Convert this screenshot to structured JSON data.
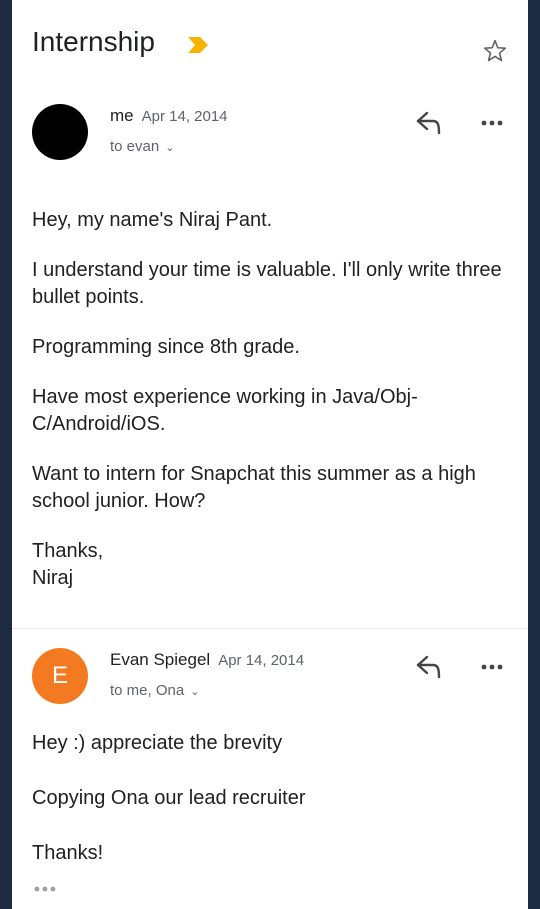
{
  "subject": "Internship",
  "icons": {
    "label": "label-marker-icon",
    "star": "star-icon",
    "reply": "reply-icon",
    "more": "more-horiz-icon",
    "trimmed": "trimmed-content-icon",
    "chevron": "chevron-down-icon"
  },
  "colors": {
    "label_marker": "#f6b400",
    "avatar_e": "#f47a21",
    "secondary_text": "#5f6368"
  },
  "messages": [
    {
      "sender": "me",
      "date": "Apr 14, 2014",
      "recipients": "to evan",
      "avatar_letter": "",
      "body": [
        "Hey, my name's Niraj Pant.",
        "I understand your time is valuable. I'll only write three bullet points.",
        "Programming since 8th grade.",
        "Have most experience working in Java/Obj-C/Android/iOS.",
        "Want to intern for Snapchat this summer as a high school junior. How?",
        "Thanks,\nNiraj"
      ]
    },
    {
      "sender": "Evan Spiegel",
      "date": "Apr 14, 2014",
      "recipients": "to me, Ona",
      "avatar_letter": "E",
      "body": [
        "Hey :) appreciate the brevity",
        "Copying Ona our lead recruiter",
        "Thanks!"
      ]
    }
  ]
}
